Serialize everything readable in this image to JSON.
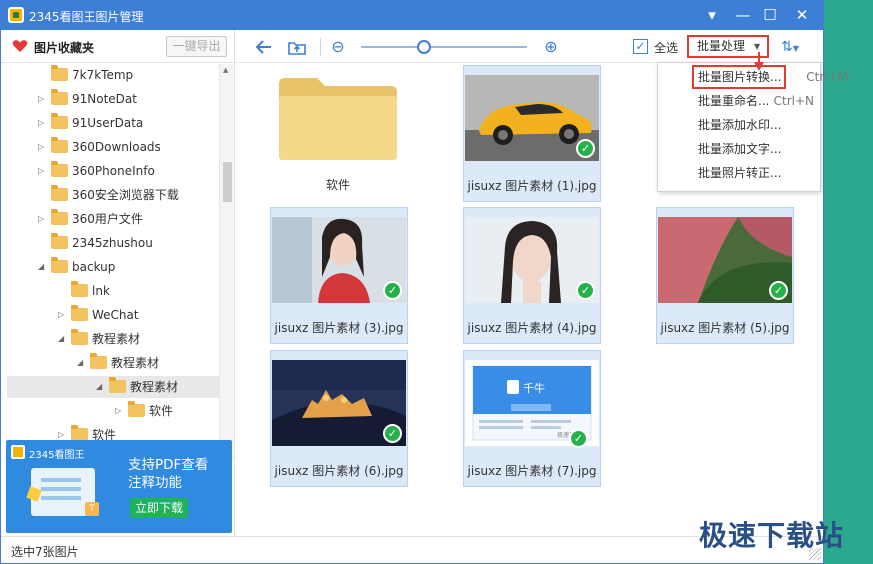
{
  "window": {
    "title": "2345看图王图片管理",
    "controls": {
      "dropdown": "▾",
      "minimize": "—",
      "maximize": "☐",
      "close": "✕"
    }
  },
  "sidebar": {
    "favorites_label": "图片收藏夹",
    "export_button": "一键导出",
    "tree": [
      {
        "label": "7k7kTemp",
        "expandable": false
      },
      {
        "label": "91NoteDat",
        "expandable": true
      },
      {
        "label": "91UserData",
        "expandable": true
      },
      {
        "label": "360Downloads",
        "expandable": true
      },
      {
        "label": "360PhoneInfo",
        "expandable": true
      },
      {
        "label": "360安全浏览器下载",
        "expandable": false
      },
      {
        "label": "360用户文件",
        "expandable": true
      },
      {
        "label": "2345zhushou",
        "expandable": false
      },
      {
        "label": "backup",
        "expandable": true,
        "expanded": true
      },
      {
        "label": "lnk",
        "expandable": false
      },
      {
        "label": "WeChat",
        "expandable": true
      },
      {
        "label": "教程素材",
        "expandable": true,
        "expanded": true
      },
      {
        "label": "教程素材",
        "expandable": true,
        "expanded": true
      },
      {
        "label": "教程素材",
        "expandable": true,
        "expanded": true,
        "selected": true
      },
      {
        "label": "软件",
        "expandable": true
      },
      {
        "label": "软件",
        "expandable": true
      }
    ]
  },
  "banner": {
    "brand": "2345看图王",
    "title_line1": "支持PDF查看",
    "title_line2": "注释功能",
    "cta": "立即下载",
    "badge": "T"
  },
  "toolbar": {
    "back_icon": "back-arrow-icon",
    "up_icon": "folder-up-icon",
    "zoom_out": "⊖",
    "zoom_in": "⊕",
    "zoom_level": 0.38,
    "select_all": "全选",
    "batch_label": "批量处理"
  },
  "batch_menu": [
    {
      "label": "批量图片转换...",
      "shortcut": "Ctrl+M"
    },
    {
      "label": "批量重命名...",
      "shortcut": "Ctrl+N"
    },
    {
      "label": "批量添加水印...",
      "shortcut": ""
    },
    {
      "label": "批量添加文字...",
      "shortcut": ""
    },
    {
      "label": "批量照片转正...",
      "shortcut": ""
    }
  ],
  "content": {
    "folder_label": "软件",
    "images": [
      {
        "label": "jisuxz 图片素材 (1).jpg",
        "kind": "car",
        "checked": true
      },
      {
        "label": "jisuxz 图片素材 (3).jpg",
        "kind": "portrait-red",
        "checked": true
      },
      {
        "label": "jisuxz 图片素材 (4).jpg",
        "kind": "portrait-light",
        "checked": true
      },
      {
        "label": "jisuxz 图片素材 (5).jpg",
        "kind": "aerial",
        "checked": true
      },
      {
        "label": "jisuxz 图片素材 (6).jpg",
        "kind": "castle-night",
        "checked": true
      },
      {
        "label": "jisuxz 图片素材 (7).jpg",
        "kind": "app-screenshot",
        "checked": true
      }
    ],
    "app_thumb_text": "千牛",
    "app_thumb_footer": "极速下载"
  },
  "status": {
    "text": "选中7张图片"
  },
  "watermark": "极速下载站",
  "colors": {
    "titlebar": "#3d7fd6",
    "accent": "#3d7fd6",
    "highlight_border": "#e53935",
    "check": "#25b04a",
    "desktop": "#2aa98f"
  }
}
